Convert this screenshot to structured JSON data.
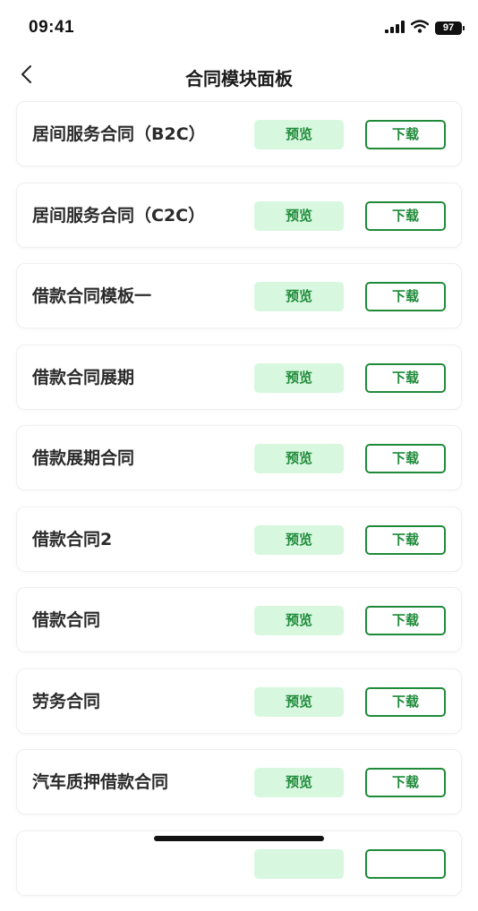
{
  "status_bar": {
    "time": "09:41",
    "battery": "97",
    "icons": [
      "signal-icon",
      "wifi-icon",
      "battery-icon"
    ]
  },
  "header": {
    "title": "合同模块面板",
    "back_icon": "chevron-left-icon"
  },
  "contracts": [
    {
      "title": "居间服务合同（B2C）",
      "preview": "预览",
      "download": "下载"
    },
    {
      "title": "居间服务合同（C2C）",
      "preview": "预览",
      "download": "下载"
    },
    {
      "title": "借款合同模板一",
      "preview": "预览",
      "download": "下载"
    },
    {
      "title": "借款合同展期",
      "preview": "预览",
      "download": "下载"
    },
    {
      "title": "借款展期合同",
      "preview": "预览",
      "download": "下载"
    },
    {
      "title": "借款合同2",
      "preview": "预览",
      "download": "下载"
    },
    {
      "title": "借款合同",
      "preview": "预览",
      "download": "下载"
    },
    {
      "title": "劳务合同",
      "preview": "预览",
      "download": "下载"
    },
    {
      "title": "汽车质押借款合同",
      "preview": "预览",
      "download": "下载"
    },
    {
      "title": "",
      "preview": "",
      "download": ""
    }
  ],
  "colors": {
    "accent": "#1f8b3a",
    "preview_bg": "#d8f7df",
    "card_border": "#eef0ee"
  }
}
